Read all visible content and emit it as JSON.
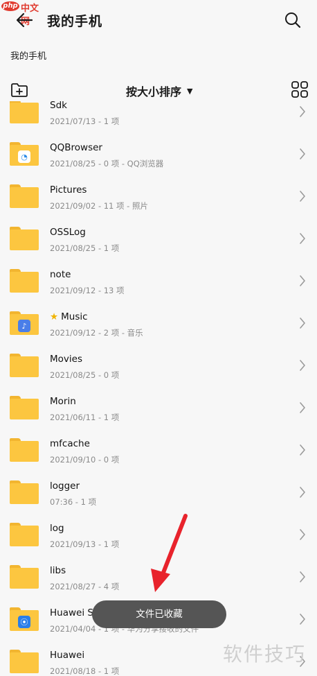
{
  "watermark_logo": {
    "mark": "php",
    "text": "中文网"
  },
  "header": {
    "title": "我的手机"
  },
  "breadcrumb": "我的手机",
  "toolbar": {
    "sort_label": "按大小排序",
    "sort_arrow": "▼"
  },
  "items": [
    {
      "name": "Sdk",
      "meta": "2021/07/13 - 1 项",
      "icon": "folder"
    },
    {
      "name": "QQBrowser",
      "meta": "2021/08/25 - 0 项 - QQ浏览器",
      "icon": "folder-qqbrowser"
    },
    {
      "name": "Pictures",
      "meta": "2021/09/02 - 11 项 - 照片",
      "icon": "folder"
    },
    {
      "name": "OSSLog",
      "meta": "2021/08/25 - 1 项",
      "icon": "folder"
    },
    {
      "name": "note",
      "meta": "2021/09/12 - 13 项",
      "icon": "folder"
    },
    {
      "name": "Music",
      "meta": "2021/09/12 - 2 项 - 音乐",
      "icon": "folder-music",
      "starred": true
    },
    {
      "name": "Movies",
      "meta": "2021/08/25 - 0 项",
      "icon": "folder"
    },
    {
      "name": "Morin",
      "meta": "2021/06/11 - 1 项",
      "icon": "folder"
    },
    {
      "name": "mfcache",
      "meta": "2021/09/10 - 0 项",
      "icon": "folder"
    },
    {
      "name": "logger",
      "meta": "07:36 - 1 项",
      "icon": "folder"
    },
    {
      "name": "log",
      "meta": "2021/09/13 - 1 项",
      "icon": "folder"
    },
    {
      "name": "libs",
      "meta": "2021/08/27 - 4 项",
      "icon": "folder"
    },
    {
      "name": "Huawei Sh",
      "meta": "2021/04/04 - 1 项 - 华为分享接收的文件",
      "icon": "folder-huawei-share"
    },
    {
      "name": "Huawei",
      "meta": "2021/08/18 - 1 项",
      "icon": "folder"
    }
  ],
  "toast": "文件已收藏",
  "corner_watermark": "软件技巧",
  "colors": {
    "folder": "#fcc640",
    "folder_tab": "#f2b530",
    "toast_bg": "#555555",
    "arrow": "#e8232c",
    "star": "#f0b400"
  }
}
